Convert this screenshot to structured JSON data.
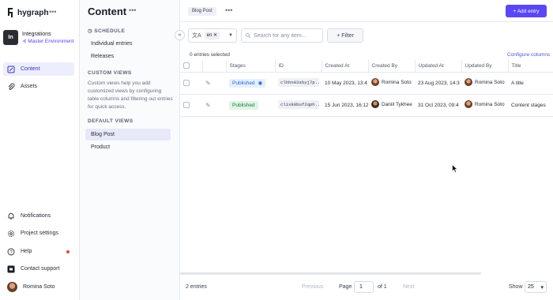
{
  "brand": {
    "name": "hygraph",
    "menu_icon": "more-dots-icon"
  },
  "project": {
    "initials": "In",
    "name": "Integrations",
    "environment": "Master Environment"
  },
  "nav": {
    "content": "Content",
    "assets": "Assets",
    "notifications": "Notifications",
    "project_settings": "Project settings",
    "help": "Help",
    "contact_support": "Contact support",
    "user": "Romina Soto"
  },
  "content_sidebar": {
    "title": "Content",
    "schedule_heading": "SCHEDULE",
    "schedule_items": [
      "Individual entries",
      "Releases"
    ],
    "custom_views_heading": "CUSTOM VIEWS",
    "custom_views_desc": "Custom views help you add customized views by configuring table columns and filtering out entries for quick access.",
    "default_views_heading": "DEFAULT VIEWS",
    "default_views": [
      "Blog Post",
      "Product"
    ]
  },
  "main": {
    "model_tag": "Blog Post",
    "add_entry": "+ Add entry",
    "locale": "en",
    "search_placeholder": "Search for any item...",
    "filter": "+ Filter",
    "selected": "0 entries selected",
    "configure": "Configure columns",
    "columns": [
      "Stages",
      "ID",
      "Created At",
      "Created By",
      "Updated At",
      "Updated By",
      "Title"
    ],
    "rows": [
      {
        "stage": "Published",
        "id": "clhhn03sbyj7p...",
        "created_at": "10 May 2023, 13:4",
        "created_by": "Romina Soto",
        "updated_at": "23 Aug 2023, 14:3",
        "updated_by": "Romina Soto",
        "title": "A title"
      },
      {
        "stage": "Published",
        "id": "clix80buf2qph...",
        "created_at": "15 Jun 2023, 16:12",
        "created_by": "Daniil Tykhee",
        "updated_at": "31 Oct 2023, 09:4",
        "updated_by": "Romina Soto",
        "title": "Content stages"
      }
    ]
  },
  "footer": {
    "entries": "2 entries",
    "previous": "Previous",
    "page_label": "Page",
    "page_value": "1",
    "of": "of 1",
    "next": "Next",
    "show_label": "Show",
    "show_value": "25"
  },
  "colors": {
    "accent": "#5b46f5",
    "published_blue": "#2d63d8",
    "published_green": "#1f7a41"
  }
}
